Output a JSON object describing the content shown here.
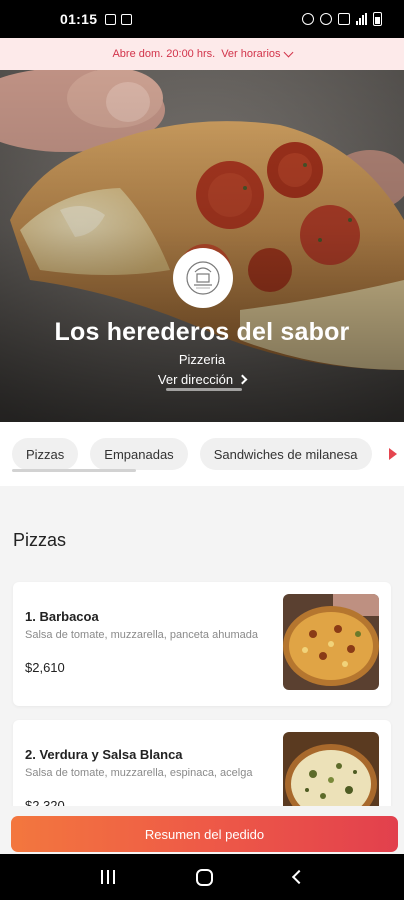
{
  "status_bar": {
    "time": "01:15",
    "icons": [
      "gallery-icon",
      "app-icon",
      "alarm-icon",
      "wifi-icon",
      "nfc-icon",
      "signal-icon",
      "battery-icon"
    ]
  },
  "hours_banner": {
    "text": "Abre dom. 20:00 hrs.",
    "link_label": "Ver horarios"
  },
  "restaurant": {
    "name": "Los herederos del sabor",
    "category": "Pizzeria",
    "address_link": "Ver dirección"
  },
  "category_tabs": [
    {
      "label": "Pizzas",
      "selected": true
    },
    {
      "label": "Empanadas",
      "selected": false
    },
    {
      "label": "Sandwiches de milanesa",
      "selected": false
    }
  ],
  "section": {
    "title": "Pizzas"
  },
  "products": [
    {
      "name": "1. Barbacoa",
      "description": "Salsa de tomate, muzzarella, panceta ahumada",
      "price": "$2,610"
    },
    {
      "name": "2. Verdura y Salsa Blanca",
      "description": "Salsa de tomate, muzzarella, espinaca, acelga",
      "price": "$2,320"
    }
  ],
  "cta": {
    "label": "Resumen del pedido"
  },
  "colors": {
    "accent": "#e5454f",
    "banner_bg": "#fdeaea",
    "cta_start": "#f3773e",
    "cta_end": "#e2404d"
  }
}
